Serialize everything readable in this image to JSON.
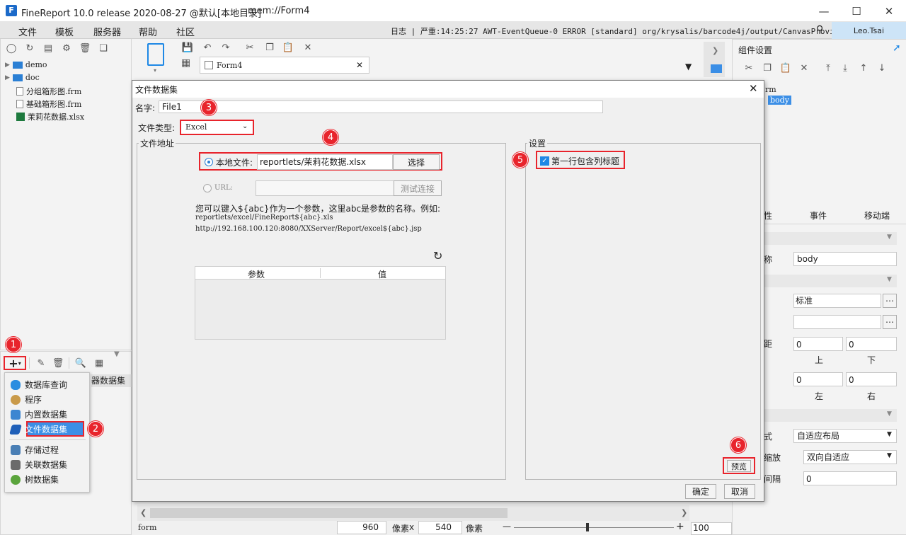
{
  "app": {
    "title": "FineReport 10.0 release 2020-08-27 @默认[本地目录]",
    "subtitle": "mem://Form4"
  },
  "menubar": {
    "items": [
      "文件",
      "模板",
      "服务器",
      "帮助",
      "社区"
    ],
    "log": "日志 | 严重:14:25:27 AWT-EventQueue-0 ERROR [standard] org/krysalis/barcode4j/output/CanvasProvider",
    "user": "Leo.Tsai"
  },
  "tree": {
    "items": [
      "demo",
      "doc",
      "分组箱形图.frm",
      "基础箱形图.frm",
      "茉莉花数据.xlsx"
    ]
  },
  "editor": {
    "tab": "Form4"
  },
  "right_panel": {
    "title": "组件设置",
    "tree_form": "rm",
    "tree_body": "body",
    "tabs": [
      "性",
      "事件",
      "移动端"
    ],
    "rows": {
      "name_label": "称",
      "name_value": "body",
      "style_value": "标准",
      "padding_label": "距",
      "top_val": "0",
      "bottom_val": "0",
      "left_val": "0",
      "right_val": "0",
      "top": "上",
      "bottom": "下",
      "left": "左",
      "right": "右",
      "layout_label": "式",
      "layout_value": "自适应布局",
      "scale_label": "缩放",
      "scale_value": "双向自适应",
      "gap_label": "间隔",
      "gap_value": "0"
    }
  },
  "dataset_menu": {
    "items": [
      "数据库查询",
      "程序",
      "内置数据集",
      "文件数据集",
      "存储过程",
      "关联数据集",
      "树数据集"
    ],
    "behind_label": "器数据集"
  },
  "dialog": {
    "title": "文件数据集",
    "name_label": "名字:",
    "name_value": "File1",
    "type_label": "文件类型:",
    "type_value": "Excel",
    "address_group": "文件地址",
    "local_label": "本地文件:",
    "local_value": "reportlets/茉莉花数据.xlsx",
    "choose": "选择",
    "url_label": "URL:",
    "test_conn": "测试连接",
    "hint1": "您可以键入${abc}作为一个参数，这里abc是参数的名称。例如:",
    "hint2": "reportlets/excel/FineReport${abc}.xls",
    "hint3": "http://192.168.100.120:8080/XXServer/Report/excel${abc}.jsp",
    "col_param": "参数",
    "col_value": "值",
    "settings_group": "设置",
    "first_row_header": "第一行包含列标题",
    "preview": "预览",
    "ok": "确定",
    "cancel": "取消"
  },
  "badges": [
    "1",
    "2",
    "3",
    "4",
    "5",
    "6"
  ],
  "statusbar": {
    "mode": "form",
    "width": "960",
    "px1": "像素",
    "x": "x",
    "height": "540",
    "px2": "像素",
    "zoom": "100"
  },
  "colors": {
    "accent": "#1e88e5",
    "highlight": "#e8242c",
    "selection": "#cde4f7"
  }
}
